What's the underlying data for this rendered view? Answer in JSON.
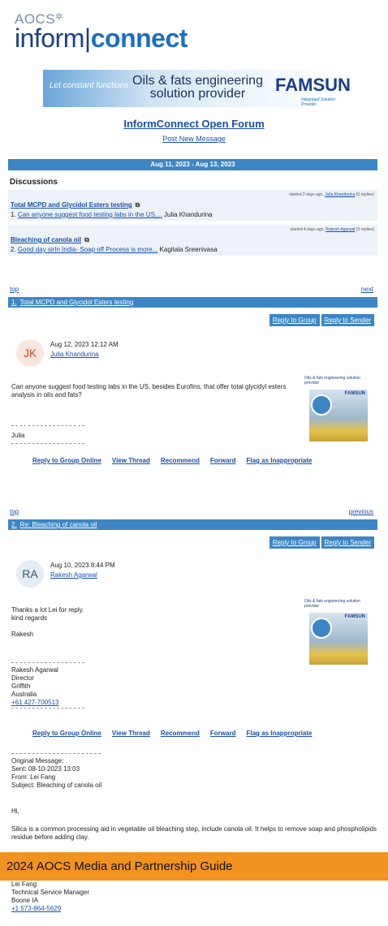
{
  "header": {
    "org": "AOCS",
    "wordmark_light": "inform",
    "wordmark_bold": "connect",
    "banner": {
      "script": "Let constant functions",
      "slogan_line1": "Oils & fats engineering",
      "slogan_line2": "solution provider",
      "brand": "FAMSUN",
      "brand_sub": "Integrated Solution Provider"
    }
  },
  "forum": {
    "title": "InformConnect Open Forum",
    "post_new": "Post New Message",
    "date_range": "Aug 11, 2023 - Aug 13, 2023",
    "discussions_label": "Discussions"
  },
  "discussions": [
    {
      "meta_prefix": "started 2 days ago,",
      "meta_author": "Julia Khandurina",
      "meta_suffix": "(0 replies)",
      "title": "Total MCPD and Glycidol Esters testing",
      "num": "1.",
      "preview": "Can anyone suggest food testing labs in the US,...",
      "author": "Julia Khandurina"
    },
    {
      "meta_prefix": "started 4 days ago,",
      "meta_author": "Rakesh Agarwal",
      "meta_suffix": "(3 replies)",
      "title": "Bleaching of canola oil",
      "num": "2.",
      "preview": "Good day sirIn India- Soap off Process is more...",
      "author": "Kagitala Sreenivasa"
    }
  ],
  "messages": [
    {
      "nav_left": "top",
      "nav_right": "next",
      "bar_num": "1.",
      "bar_title": "Total MCPD and Glycidol Esters testing",
      "reply_group": "Reply to Group",
      "reply_sender": "Reply to Sender",
      "initials": "JK",
      "datetime": "Aug 12, 2023 12:12 AM",
      "author": "Julia Khandurina",
      "body": "Can anyone suggest food testing labs in the US, besides Eurofins, that offer total glycidyl esters analysis in oils and fats?",
      "sig_name": "Julia",
      "ad_text": "Oils & fats engineering solution provider",
      "ad_brand": "FAMSUN",
      "actions": [
        "Reply to Group Online",
        "View Thread",
        "Recommend",
        "Forward",
        "Flag as Inappropriate"
      ]
    },
    {
      "nav_left": "top",
      "nav_right": "previous",
      "bar_num": "2.",
      "bar_title": "Re: Bleaching of canola oil",
      "reply_group": "Reply to Group",
      "reply_sender": "Reply to Sender",
      "initials": "RA",
      "datetime": "Aug 10, 2023 8:44 PM",
      "author": "Rakesh Agarwal",
      "body1": "Thanks a lot Lei for reply.",
      "body2": "kind regards",
      "body3": "Rakesh",
      "sig_lines": [
        "Rakesh Agarwal",
        "Director",
        "Griffith",
        "Australia"
      ],
      "sig_phone": "+61 427-700513",
      "ad_text": "Oils & fats engineering solution provider",
      "ad_brand": "FAMSUN",
      "actions": [
        "Reply to Group Online",
        "View Thread",
        "Recommend",
        "Forward",
        "Flag as Inappropriate"
      ],
      "orig_label": "Original Message:",
      "orig_sent": "Sent: 08-10-2023 13:03",
      "orig_from": "From: Lei Fang",
      "orig_subject": "Subject: Bleaching of canola oil",
      "greeting": "Hi,",
      "reply_body": "Silica is a common processing aid in vegetable oil bleaching step, include canola oil. It helps to remove soap and phospholipids residue before adding clay.",
      "footer_name": "Lei Fang",
      "footer_title": "Technical Service Manager",
      "footer_city": "Boone IA",
      "footer_phone": "+1 573-864-5629"
    }
  ],
  "promo": {
    "label": "2024 AOCS Media and Partnership Guide"
  }
}
